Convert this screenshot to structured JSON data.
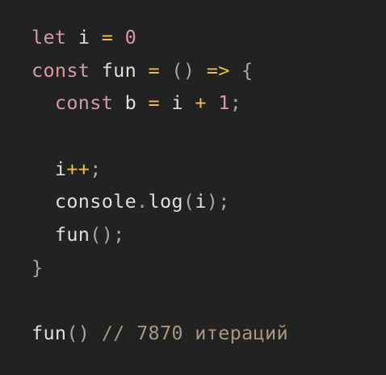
{
  "editor": {
    "lines": [
      {
        "tokens": [
          {
            "t": "let",
            "c": "kw"
          },
          {
            "t": " ",
            "c": "ident"
          },
          {
            "t": "i",
            "c": "ident"
          },
          {
            "t": " ",
            "c": "ident"
          },
          {
            "t": "=",
            "c": "op"
          },
          {
            "t": " ",
            "c": "ident"
          },
          {
            "t": "0",
            "c": "num"
          }
        ]
      },
      {
        "tokens": [
          {
            "t": "const",
            "c": "kw"
          },
          {
            "t": " ",
            "c": "ident"
          },
          {
            "t": "fun",
            "c": "ident"
          },
          {
            "t": " ",
            "c": "ident"
          },
          {
            "t": "=",
            "c": "op"
          },
          {
            "t": " ",
            "c": "ident"
          },
          {
            "t": "()",
            "c": "punct"
          },
          {
            "t": " ",
            "c": "ident"
          },
          {
            "t": "=>",
            "c": "op"
          },
          {
            "t": " ",
            "c": "ident"
          },
          {
            "t": "{",
            "c": "punct"
          }
        ]
      },
      {
        "tokens": [
          {
            "t": "  ",
            "c": "ident"
          },
          {
            "t": "const",
            "c": "kw"
          },
          {
            "t": " ",
            "c": "ident"
          },
          {
            "t": "b",
            "c": "ident"
          },
          {
            "t": " ",
            "c": "ident"
          },
          {
            "t": "=",
            "c": "op"
          },
          {
            "t": " ",
            "c": "ident"
          },
          {
            "t": "i",
            "c": "ident"
          },
          {
            "t": " ",
            "c": "ident"
          },
          {
            "t": "+",
            "c": "op"
          },
          {
            "t": " ",
            "c": "ident"
          },
          {
            "t": "1",
            "c": "num"
          },
          {
            "t": ";",
            "c": "punct"
          }
        ]
      },
      {
        "tokens": []
      },
      {
        "tokens": [
          {
            "t": "  ",
            "c": "ident"
          },
          {
            "t": "i",
            "c": "ident"
          },
          {
            "t": "++",
            "c": "op"
          },
          {
            "t": ";",
            "c": "punct"
          }
        ]
      },
      {
        "tokens": [
          {
            "t": "  ",
            "c": "ident"
          },
          {
            "t": "console",
            "c": "ident"
          },
          {
            "t": ".",
            "c": "punct"
          },
          {
            "t": "log",
            "c": "ident"
          },
          {
            "t": "(",
            "c": "punct"
          },
          {
            "t": "i",
            "c": "ident"
          },
          {
            "t": ")",
            "c": "punct"
          },
          {
            "t": ";",
            "c": "punct"
          }
        ]
      },
      {
        "tokens": [
          {
            "t": "  ",
            "c": "ident"
          },
          {
            "t": "fun",
            "c": "ident"
          },
          {
            "t": "()",
            "c": "punct"
          },
          {
            "t": ";",
            "c": "punct"
          }
        ]
      },
      {
        "tokens": [
          {
            "t": "}",
            "c": "punct"
          }
        ]
      },
      {
        "tokens": []
      },
      {
        "tokens": [
          {
            "t": "fun",
            "c": "ident"
          },
          {
            "t": "()",
            "c": "punct"
          },
          {
            "t": " ",
            "c": "ident"
          },
          {
            "t": "// 7870 итераций",
            "c": "comment"
          }
        ]
      }
    ]
  },
  "colors": {
    "background": "#222222",
    "keyword": "#d49ba5",
    "operator": "#efbf44",
    "number": "#d49ba5",
    "punctuation": "#a6a6a6",
    "identifier": "#dedede",
    "comment": "#a9967e"
  }
}
